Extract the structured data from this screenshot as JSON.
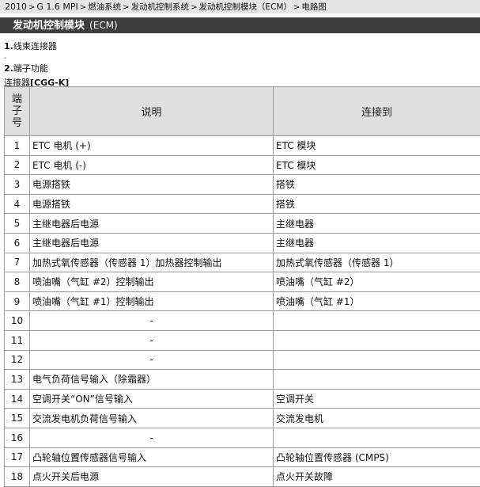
{
  "breadcrumb": {
    "items": [
      "2010",
      "G 1.6 MPI",
      "燃油系统",
      "发动机控制系统",
      "发动机控制模块（ECM）",
      "电路图"
    ],
    "separator": ">"
  },
  "title": {
    "main": "发动机控制模块",
    "sub": "(ECM)"
  },
  "section1": {
    "num": "1.",
    "label": "线束连接器"
  },
  "dot_marker": "-",
  "section2": {
    "num": "2.",
    "label": "端子功能"
  },
  "connector": {
    "prefix": "连接器",
    "id": "[CGG-K]"
  },
  "table": {
    "headers": {
      "pin": [
        "端",
        "子",
        "号"
      ],
      "desc": "说明",
      "connect": "连接到"
    },
    "rows": [
      {
        "pin": "1",
        "desc": "ETC 电机 (+)",
        "to": "ETC 模块"
      },
      {
        "pin": "2",
        "desc": "ETC 电机 (-)",
        "to": "ETC 模块"
      },
      {
        "pin": "3",
        "desc": "电源搭铁",
        "to": "搭铁"
      },
      {
        "pin": "4",
        "desc": "电源搭铁",
        "to": "搭铁"
      },
      {
        "pin": "5",
        "desc": "主继电器后电源",
        "to": "主继电器"
      },
      {
        "pin": "6",
        "desc": "主继电器后电源",
        "to": "主继电器"
      },
      {
        "pin": "7",
        "desc": "加热式氧传感器（传感器 1）加热器控制输出",
        "to": "加热式氧传感器（传感器 1）"
      },
      {
        "pin": "8",
        "desc": "喷油嘴（气缸 #2）控制输出",
        "to": "喷油嘴（气缸 #2）"
      },
      {
        "pin": "9",
        "desc": "喷油嘴（气缸 #1）控制输出",
        "to": "喷油嘴（气缸 #1）"
      },
      {
        "pin": "10",
        "desc": "-",
        "to": ""
      },
      {
        "pin": "11",
        "desc": "-",
        "to": ""
      },
      {
        "pin": "12",
        "desc": "-",
        "to": ""
      },
      {
        "pin": "13",
        "desc": "电气负荷信号输入（除霜器）",
        "to": ""
      },
      {
        "pin": "14",
        "desc": "空调开关“ON”信号输入",
        "to": "空调开关"
      },
      {
        "pin": "15",
        "desc": "交流发电机负荷信号输入",
        "to": "交流发电机"
      },
      {
        "pin": "16",
        "desc": "-",
        "to": ""
      },
      {
        "pin": "17",
        "desc": "凸轮轴位置传感器信号输入",
        "to": "凸轮轴位置传感器 (CMPS)"
      },
      {
        "pin": "18",
        "desc": "点火开关后电源",
        "to": "点火开关故障"
      }
    ]
  }
}
